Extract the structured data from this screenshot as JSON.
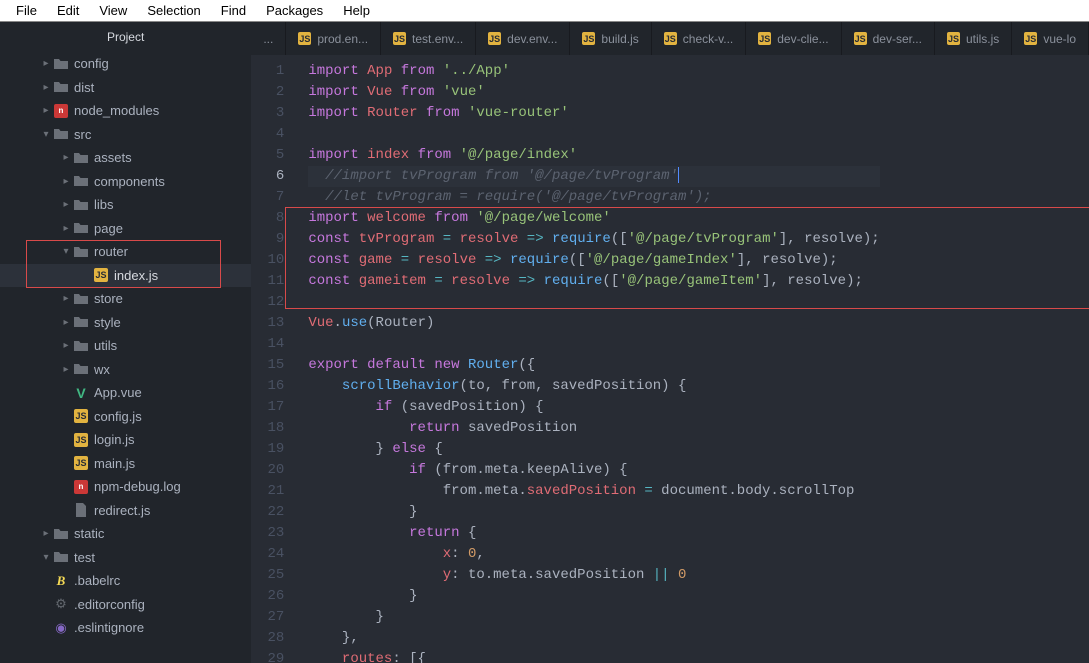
{
  "menu": [
    "File",
    "Edit",
    "View",
    "Selection",
    "Find",
    "Packages",
    "Help"
  ],
  "sidebar": {
    "title": "Project",
    "tree": [
      {
        "depth": 0,
        "arrow": "right",
        "icon": "folder",
        "label": "config"
      },
      {
        "depth": 0,
        "arrow": "right",
        "icon": "folder",
        "label": "dist"
      },
      {
        "depth": 0,
        "arrow": "right",
        "icon": "npm",
        "label": "node_modules"
      },
      {
        "depth": 0,
        "arrow": "down",
        "icon": "folder",
        "label": "src"
      },
      {
        "depth": 1,
        "arrow": "right",
        "icon": "folder",
        "label": "assets"
      },
      {
        "depth": 1,
        "arrow": "right",
        "icon": "folder",
        "label": "components"
      },
      {
        "depth": 1,
        "arrow": "right",
        "icon": "folder",
        "label": "libs"
      },
      {
        "depth": 1,
        "arrow": "right",
        "icon": "folder",
        "label": "page"
      },
      {
        "depth": 1,
        "arrow": "down",
        "icon": "folder",
        "label": "router"
      },
      {
        "depth": 2,
        "arrow": "",
        "icon": "js",
        "label": "index.js",
        "selected": true
      },
      {
        "depth": 1,
        "arrow": "right",
        "icon": "folder",
        "label": "store"
      },
      {
        "depth": 1,
        "arrow": "right",
        "icon": "folder",
        "label": "style"
      },
      {
        "depth": 1,
        "arrow": "right",
        "icon": "folder",
        "label": "utils"
      },
      {
        "depth": 1,
        "arrow": "right",
        "icon": "folder",
        "label": "wx"
      },
      {
        "depth": 1,
        "arrow": "",
        "icon": "vue",
        "label": "App.vue"
      },
      {
        "depth": 1,
        "arrow": "",
        "icon": "js",
        "label": "config.js"
      },
      {
        "depth": 1,
        "arrow": "",
        "icon": "js",
        "label": "login.js"
      },
      {
        "depth": 1,
        "arrow": "",
        "icon": "js",
        "label": "main.js"
      },
      {
        "depth": 1,
        "arrow": "",
        "icon": "npm",
        "label": "npm-debug.log"
      },
      {
        "depth": 1,
        "arrow": "",
        "icon": "file",
        "label": "redirect.js"
      },
      {
        "depth": 0,
        "arrow": "right",
        "icon": "folder",
        "label": "static"
      },
      {
        "depth": 0,
        "arrow": "down",
        "icon": "folder",
        "label": "test"
      },
      {
        "depth": 0,
        "arrow": "",
        "icon": "babel",
        "label": ".babelrc"
      },
      {
        "depth": 0,
        "arrow": "",
        "icon": "gear",
        "label": ".editorconfig"
      },
      {
        "depth": 0,
        "arrow": "",
        "icon": "eslint",
        "label": ".eslintignore"
      }
    ]
  },
  "tabs": [
    {
      "icon": "",
      "label": "..."
    },
    {
      "icon": "js",
      "label": "prod.en..."
    },
    {
      "icon": "js",
      "label": "test.env..."
    },
    {
      "icon": "js",
      "label": "dev.env..."
    },
    {
      "icon": "js",
      "label": "build.js"
    },
    {
      "icon": "js",
      "label": "check-v..."
    },
    {
      "icon": "js",
      "label": "dev-clie..."
    },
    {
      "icon": "js",
      "label": "dev-ser..."
    },
    {
      "icon": "js",
      "label": "utils.js"
    },
    {
      "icon": "js",
      "label": "vue-lo"
    }
  ],
  "code": {
    "lines": 29
  }
}
